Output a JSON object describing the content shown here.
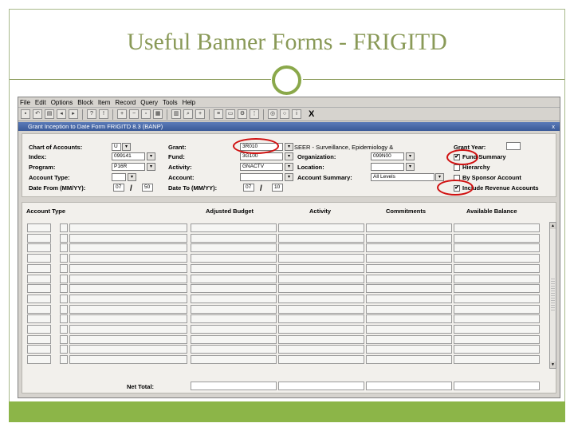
{
  "slide": {
    "title": "Useful Banner Forms - FRIGITD"
  },
  "menu": [
    "File",
    "Edit",
    "Options",
    "Block",
    "Item",
    "Record",
    "Query",
    "Tools",
    "Help"
  ],
  "toolbar": {
    "close_label": "X"
  },
  "form": {
    "title": "Grant Inception to Date Form  FRIGITD  8.3  (BANP)",
    "window_controls": "x"
  },
  "key": {
    "chart_label": "Chart of Accounts:",
    "chart_value": "U",
    "index_label": "Index:",
    "index_value": "099141",
    "program_label": "Program:",
    "program_value": "P16R",
    "account_type_label": "Account Type:",
    "account_type_value": "",
    "date_from_label": "Date From (MM/YY):",
    "date_from_mm": "07",
    "date_from_yy": "50",
    "grant_label": "Grant:",
    "grant_value": "3R010",
    "grant_desc": "SEER - Surveillance, Epidemiology &",
    "fund_label": "Fund:",
    "fund_value": "3G100",
    "activity_label": "Activity:",
    "activity_value": "GNACTV",
    "account_label": "Account:",
    "account_value": "",
    "date_to_label": "Date To (MM/YY):",
    "date_to_mm": "07",
    "date_to_yy": "10",
    "organization_label": "Organization:",
    "organization_value": "099N00",
    "location_label": "Location:",
    "location_value": "",
    "account_summary_label": "Account Summary:",
    "account_summary_value": "All Levels",
    "grant_year_label": "Grant Year:",
    "grant_year_value": "",
    "fund_summary_label": "Fund Summary",
    "fund_summary_checked": "✔",
    "hierarchy_label": "Hierarchy",
    "hierarchy_checked": "",
    "by_sponsor_label": "By Sponsor Account",
    "by_sponsor_checked": "",
    "include_revenue_label": "Include Revenue Accounts",
    "include_revenue_checked": "✔",
    "slash": "/"
  },
  "grid": {
    "columns": [
      "Account Type",
      "Adjusted Budget",
      "Activity",
      "Commitments",
      "Available Balance"
    ],
    "net_total_label": "Net Total:"
  },
  "colors": {
    "accent": "#8aa84a",
    "title": "#8a9a58",
    "bar": "#8cb548",
    "annotation": "#d01010"
  }
}
